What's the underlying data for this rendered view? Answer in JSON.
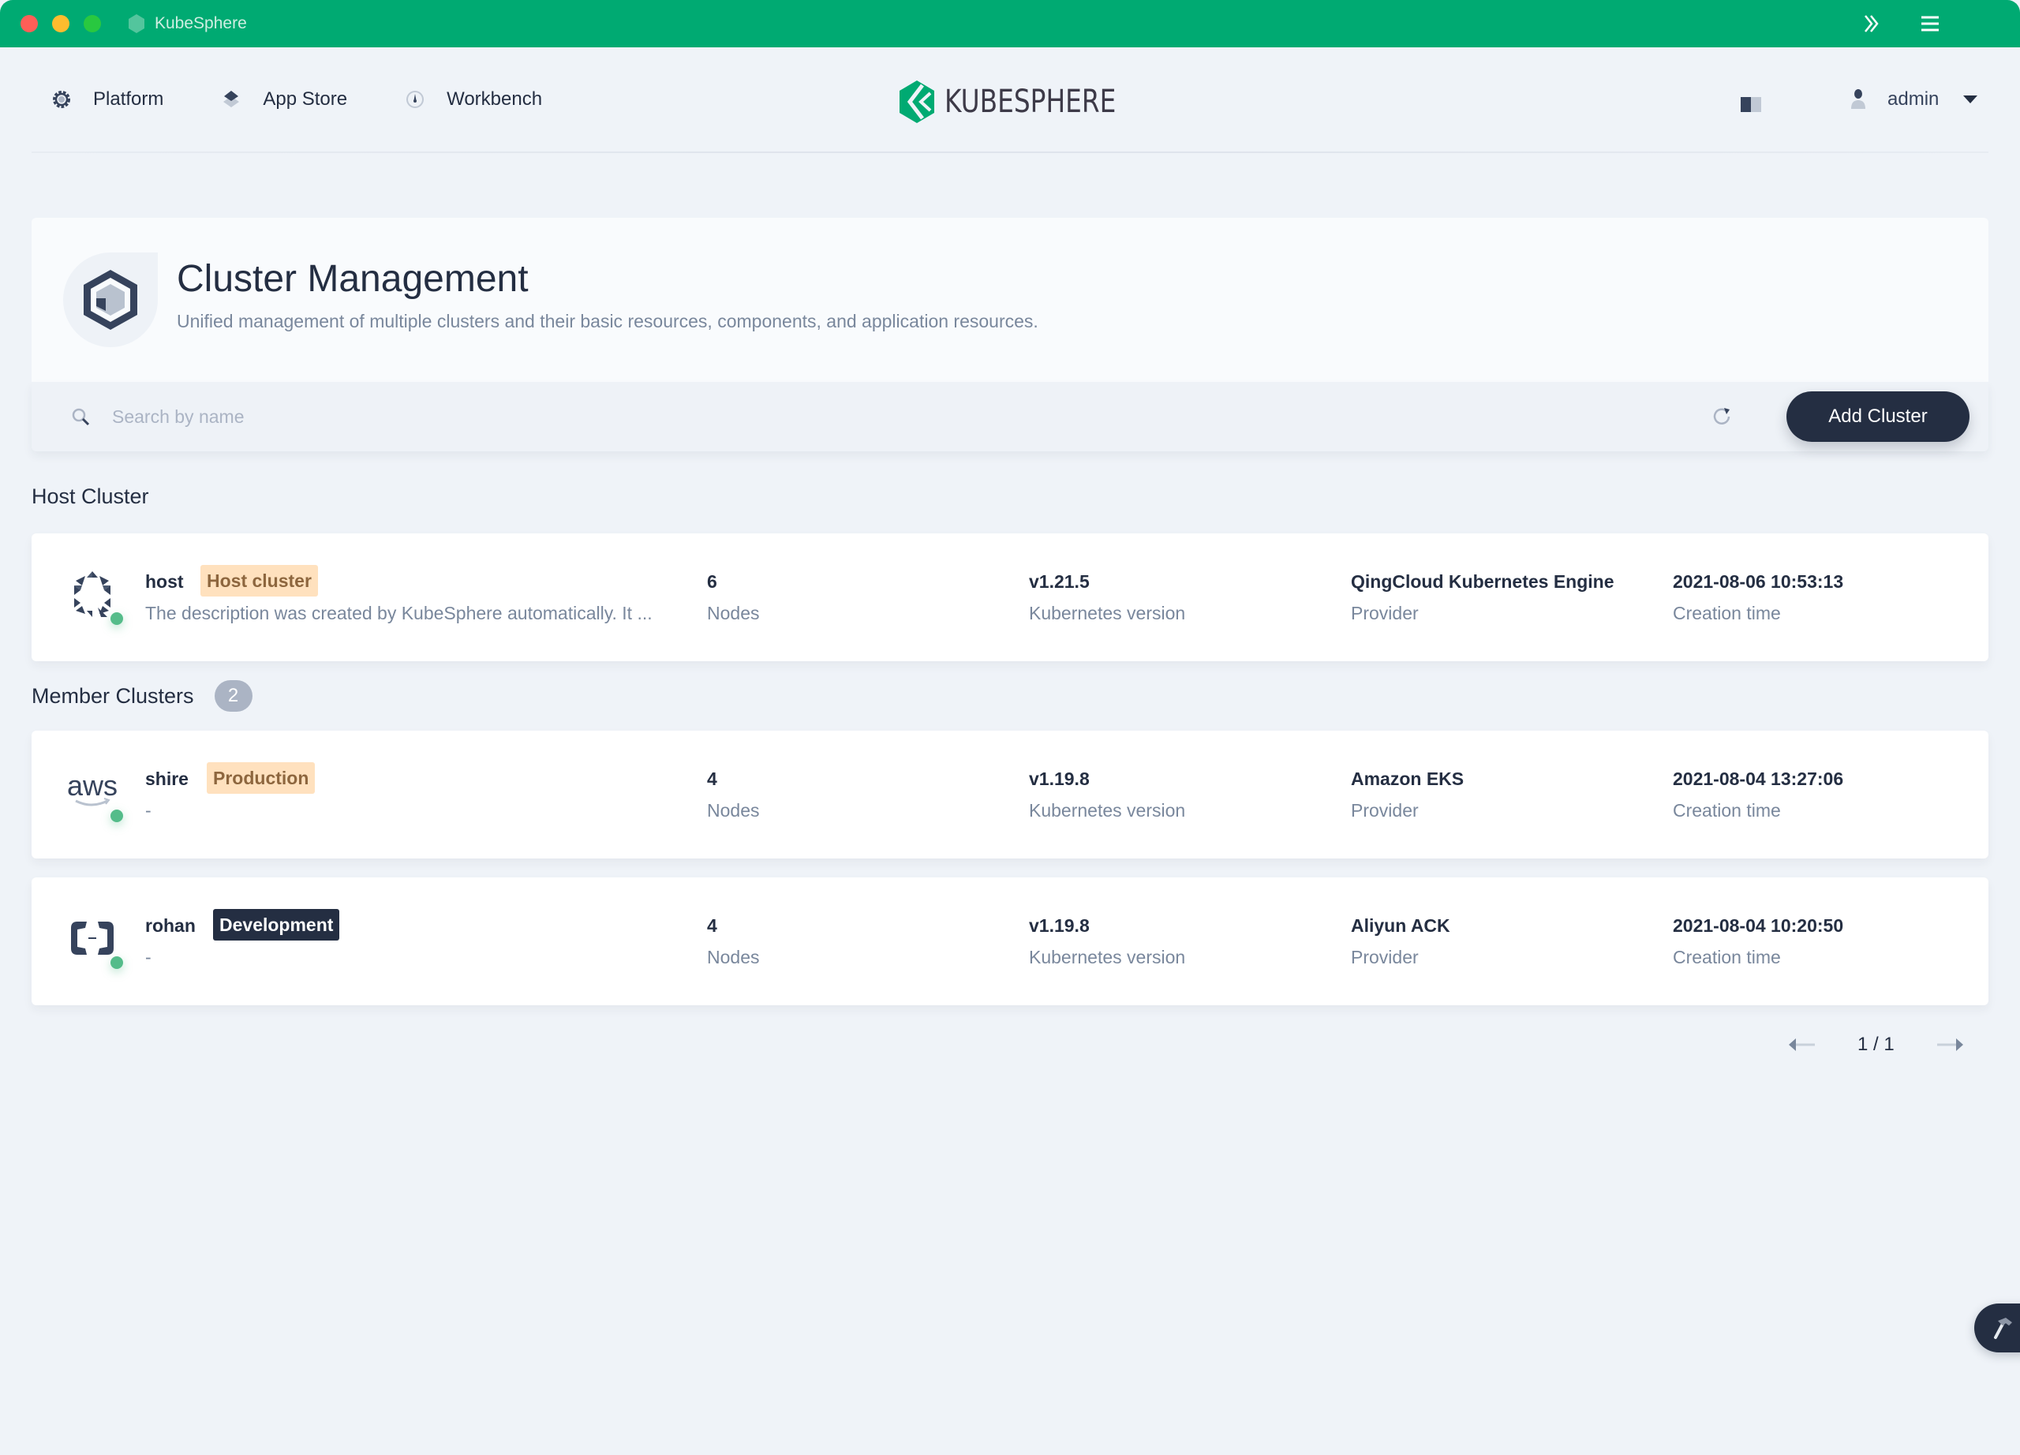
{
  "window": {
    "title": "KubeSphere",
    "title_bar_color": "#00aa72"
  },
  "topnav": {
    "items": [
      {
        "label": "Platform",
        "icon": "gear-icon"
      },
      {
        "label": "App Store",
        "icon": "layers-icon"
      },
      {
        "label": "Workbench",
        "icon": "dashboard-icon"
      }
    ],
    "brand": "KUBESPHERE",
    "brand_color": "#00aa72",
    "user": "admin"
  },
  "banner": {
    "title": "Cluster Management",
    "description": "Unified management of multiple clusters and their basic resources, components, and application resources."
  },
  "toolbar": {
    "search_placeholder": "Search by name",
    "search_value": "",
    "add_button": "Add Cluster"
  },
  "host_section": {
    "title": "Host Cluster"
  },
  "member_section": {
    "title": "Member Clusters",
    "count": "2"
  },
  "labels": {
    "nodes": "Nodes",
    "version": "Kubernetes version",
    "provider": "Provider",
    "created": "Creation time"
  },
  "clusters": [
    {
      "name": "host",
      "tag": "Host cluster",
      "tag_style": "warn",
      "description": "The description was created by KubeSphere automatically. It ...",
      "nodes": "6",
      "version": "v1.21.5",
      "provider": "QingCloud Kubernetes Engine",
      "created": "2021-08-06 10:53:13",
      "status": "running",
      "icon": "qingcloud-icon"
    },
    {
      "name": "shire",
      "tag": "Production",
      "tag_style": "warn",
      "description": "-",
      "nodes": "4",
      "version": "v1.19.8",
      "provider": "Amazon EKS",
      "created": "2021-08-04 13:27:06",
      "status": "running",
      "icon": "aws-icon",
      "icon_text": "aws"
    },
    {
      "name": "rohan",
      "tag": "Development",
      "tag_style": "dark",
      "description": "-",
      "nodes": "4",
      "version": "v1.19.8",
      "provider": "Aliyun ACK",
      "created": "2021-08-04 10:20:50",
      "status": "running",
      "icon": "aliyun-icon"
    }
  ],
  "pagination": {
    "text": "1 / 1"
  }
}
